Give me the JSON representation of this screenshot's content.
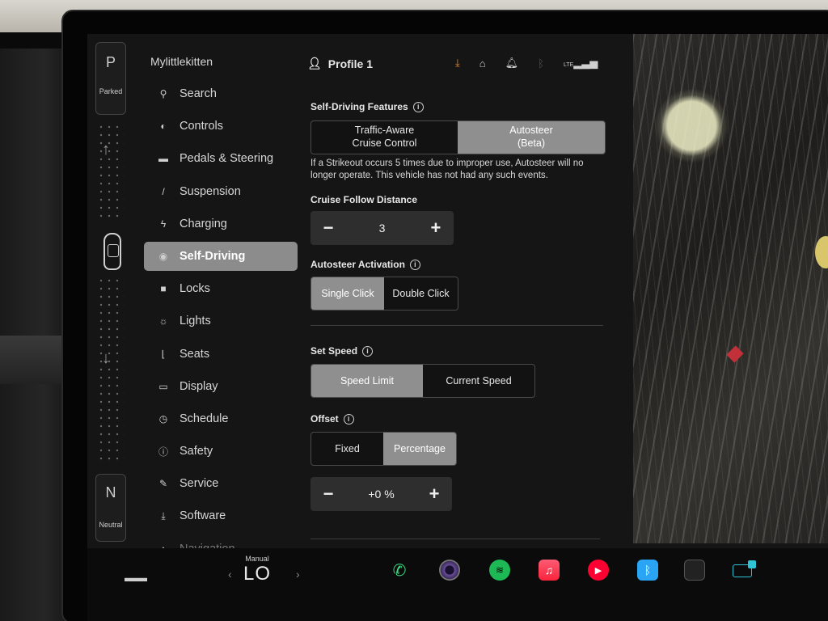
{
  "gear": {
    "top_letter": "P",
    "top_label": "Parked",
    "bottom_letter": "N",
    "bottom_label": "Neutral"
  },
  "sidebar": {
    "car_name": "Mylittlekitten",
    "items": [
      {
        "label": "Search",
        "icon": "search-icon",
        "glyph": "⚲"
      },
      {
        "label": "Controls",
        "icon": "toggle-icon",
        "glyph": "◐"
      },
      {
        "label": "Pedals & Steering",
        "icon": "car-icon",
        "glyph": "▬"
      },
      {
        "label": "Suspension",
        "icon": "suspension-icon",
        "glyph": "/"
      },
      {
        "label": "Charging",
        "icon": "bolt-icon",
        "glyph": "ϟ"
      },
      {
        "label": "Self-Driving",
        "icon": "steering-wheel-icon",
        "glyph": "◉",
        "active": true
      },
      {
        "label": "Locks",
        "icon": "lock-icon",
        "glyph": "■"
      },
      {
        "label": "Lights",
        "icon": "sun-icon",
        "glyph": "☼"
      },
      {
        "label": "Seats",
        "icon": "seat-icon",
        "glyph": "⌊"
      },
      {
        "label": "Display",
        "icon": "display-icon",
        "glyph": "▭"
      },
      {
        "label": "Schedule",
        "icon": "alarm-clock-icon",
        "glyph": "◷"
      },
      {
        "label": "Safety",
        "icon": "alert-circle-icon",
        "glyph": "ⓘ"
      },
      {
        "label": "Service",
        "icon": "wrench-icon",
        "glyph": "✎"
      },
      {
        "label": "Software",
        "icon": "download-icon",
        "glyph": "⤓"
      },
      {
        "label": "Navigation",
        "icon": "navigation-icon",
        "glyph": "▲"
      }
    ]
  },
  "header": {
    "profile_label": "Profile 1",
    "lte_label": "LTE"
  },
  "self_driving": {
    "title": "Self-Driving Features",
    "options": [
      {
        "label_line1": "Traffic-Aware",
        "label_line2": "Cruise Control",
        "selected": false
      },
      {
        "label_line1": "Autosteer",
        "label_line2": "(Beta)",
        "selected": true
      }
    ],
    "note": "If a Strikeout occurs 5 times due to improper use, Autosteer will no longer operate. This vehicle has not had any such events.",
    "follow_distance": {
      "label": "Cruise Follow Distance",
      "minus": "−",
      "value": "3",
      "plus": "+"
    },
    "activation": {
      "label": "Autosteer Activation",
      "options": [
        "Single Click",
        "Double Click"
      ],
      "selected": "Single Click"
    },
    "set_speed": {
      "label": "Set Speed",
      "options": [
        "Speed Limit",
        "Current Speed"
      ],
      "selected": "Speed Limit"
    },
    "offset": {
      "label": "Offset",
      "options": [
        "Fixed",
        "Percentage"
      ],
      "selected": "Percentage",
      "minus": "−",
      "value": "+0 %",
      "plus": "+"
    }
  },
  "dock": {
    "climate_mode": "Manual",
    "climate_value": "LO",
    "apps": [
      "phone-icon",
      "camera-icon",
      "spotify-icon",
      "apple-music-icon",
      "youtube-music-icon",
      "bluetooth-icon",
      "app-launcher-icon",
      "toybox-icon"
    ]
  },
  "colors": {
    "accent_download": "#f08a24",
    "selected_segment": "#8f8f8f",
    "active_menu": "#8c8c8c"
  }
}
